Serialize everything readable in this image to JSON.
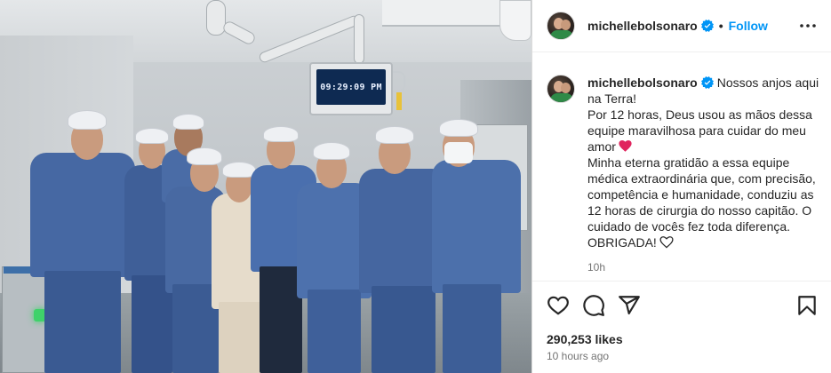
{
  "post": {
    "photo": {
      "monitor_time": "09:29:09 PM"
    },
    "header": {
      "username": "michellebolsonaro",
      "separator": "•",
      "follow_label": "Follow",
      "more_icon": "more-horizontal-icon"
    },
    "caption": {
      "username": "michellebolsonaro",
      "lines": [
        "Nossos anjos aqui",
        "na Terra!",
        "Por 12 horas, Deus usou as mãos dessa",
        "equipe maravilhosa para cuidar do meu",
        "amor",
        "Minha eterna gratidão a essa equipe",
        "médica extraordinária que, com precisão,",
        "competência e humanidade, conduziu as",
        "12 horas de cirurgia do nosso capitão. O",
        "cuidado de vocês fez toda diferença.",
        "OBRIGADA!"
      ],
      "timestamp": "10h",
      "red_heart_icon": "red-heart-emoji-icon",
      "outline_heart_icon": "white-heart-emoji-icon"
    },
    "actions": {
      "icons": [
        "like-heart-icon",
        "comment-icon",
        "share-icon",
        "save-bookmark-icon"
      ],
      "likes": "290,253 likes",
      "time_ago": "10 hours ago"
    },
    "colors": {
      "accent": "#0095f6",
      "verified_badge": "#0095f6",
      "heart": "#e0245e",
      "text": "#262626",
      "secondary": "#737373"
    }
  }
}
